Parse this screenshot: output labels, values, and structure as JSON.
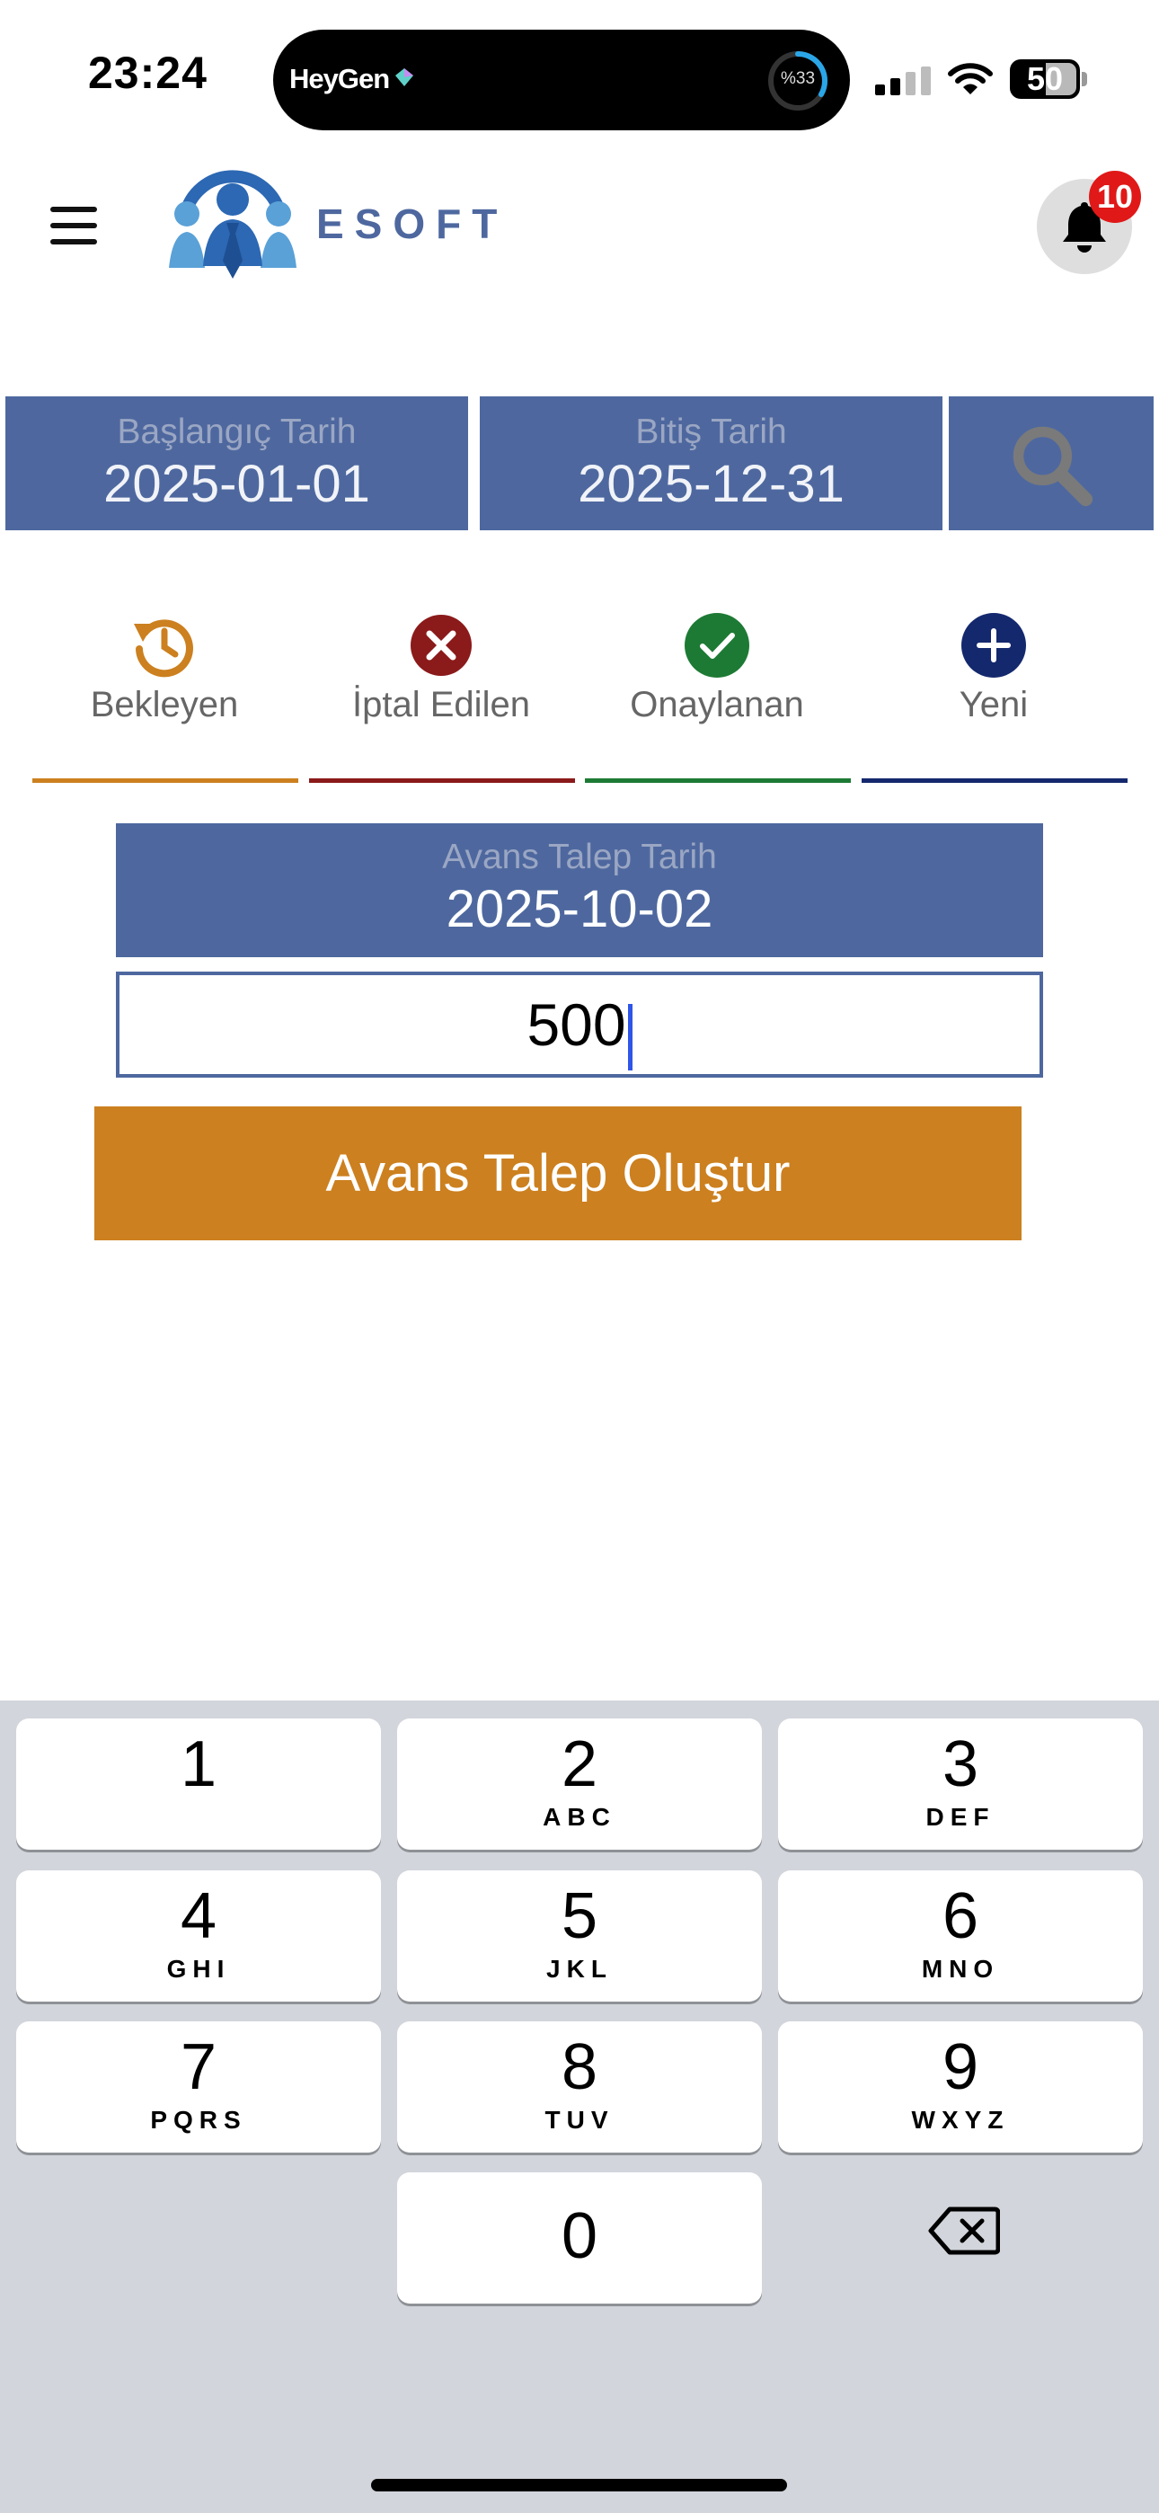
{
  "status_bar": {
    "time": "23:24",
    "island_app": "HeyGen",
    "island_progress": "%33",
    "battery": "50"
  },
  "header": {
    "brand": "ESOFT",
    "notification_count": "10"
  },
  "filter": {
    "start_label": "Başlangıç Tarih",
    "start_value": "2025-01-01",
    "end_label": "Bitiş Tarih",
    "end_value": "2025-12-31"
  },
  "tabs": [
    {
      "label": "Bekleyen",
      "icon": "history-icon",
      "color": "#cc801f"
    },
    {
      "label": "İptal Edilen",
      "icon": "cancel-circle-icon",
      "color": "#8b1a1a"
    },
    {
      "label": "Onaylanan",
      "icon": "check-circle-icon",
      "color": "#1d7a34"
    },
    {
      "label": "Yeni",
      "icon": "plus-circle-icon",
      "color": "#14286e"
    }
  ],
  "form": {
    "date_label": "Avans Talep Tarih",
    "date_value": "2025-10-02",
    "amount_value": "500",
    "submit_label": "Avans Talep Oluştur"
  },
  "keyboard": {
    "keys": [
      {
        "num": "1",
        "letters": ""
      },
      {
        "num": "2",
        "letters": "ABC"
      },
      {
        "num": "3",
        "letters": "DEF"
      },
      {
        "num": "4",
        "letters": "GHI"
      },
      {
        "num": "5",
        "letters": "JKL"
      },
      {
        "num": "6",
        "letters": "MNO"
      },
      {
        "num": "7",
        "letters": "PQRS"
      },
      {
        "num": "8",
        "letters": "TUV"
      },
      {
        "num": "9",
        "letters": "WXYZ"
      },
      {
        "num": "0",
        "letters": ""
      }
    ]
  },
  "colors": {
    "primary": "#4e689f",
    "accent": "#cc801f"
  }
}
